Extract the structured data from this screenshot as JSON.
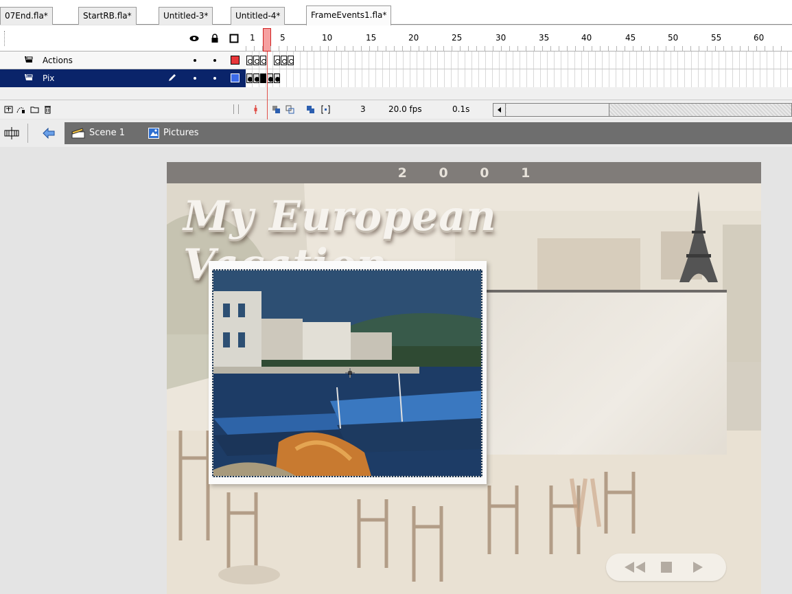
{
  "tabs": [
    {
      "label": "07End.fla*",
      "active": false
    },
    {
      "label": "StartRB.fla*",
      "active": false
    },
    {
      "label": "Untitled-3*",
      "active": false
    },
    {
      "label": "Untitled-4*",
      "active": false
    },
    {
      "label": "FrameEvents1.fla*",
      "active": true
    }
  ],
  "timeline": {
    "ruler_numbers": [
      "1",
      "5",
      "10",
      "15",
      "20",
      "25",
      "30",
      "35",
      "40",
      "45",
      "50",
      "55",
      "60"
    ],
    "header_icons": [
      "eye-icon",
      "lock-icon",
      "outline-icon"
    ],
    "layers": [
      {
        "name": "Actions",
        "color": "#e8373a",
        "selected": false,
        "keyframes": 6
      },
      {
        "name": "Pix",
        "color": "#3b6ae8",
        "selected": true,
        "keyframes": 5
      }
    ],
    "current_frame": "3",
    "frame_rate": "20.0 fps",
    "elapsed_time": "0.1s"
  },
  "editbar": {
    "scene_label": "Scene 1",
    "symbol_label": "Pictures",
    "icons": [
      "timeline-toggle-icon",
      "back-arrow-icon",
      "scene-clapper-icon",
      "graphic-symbol-icon"
    ]
  },
  "stage": {
    "year": "2 0 0 1",
    "title": "My European Vacation",
    "nav_buttons": [
      "rewind-icon",
      "stop-icon",
      "play-icon"
    ]
  },
  "colors": {
    "selected_layer": "#0a246a",
    "playhead": "#e0504a",
    "stage_header": "#807c79",
    "editbar": "#6e6e6e"
  }
}
